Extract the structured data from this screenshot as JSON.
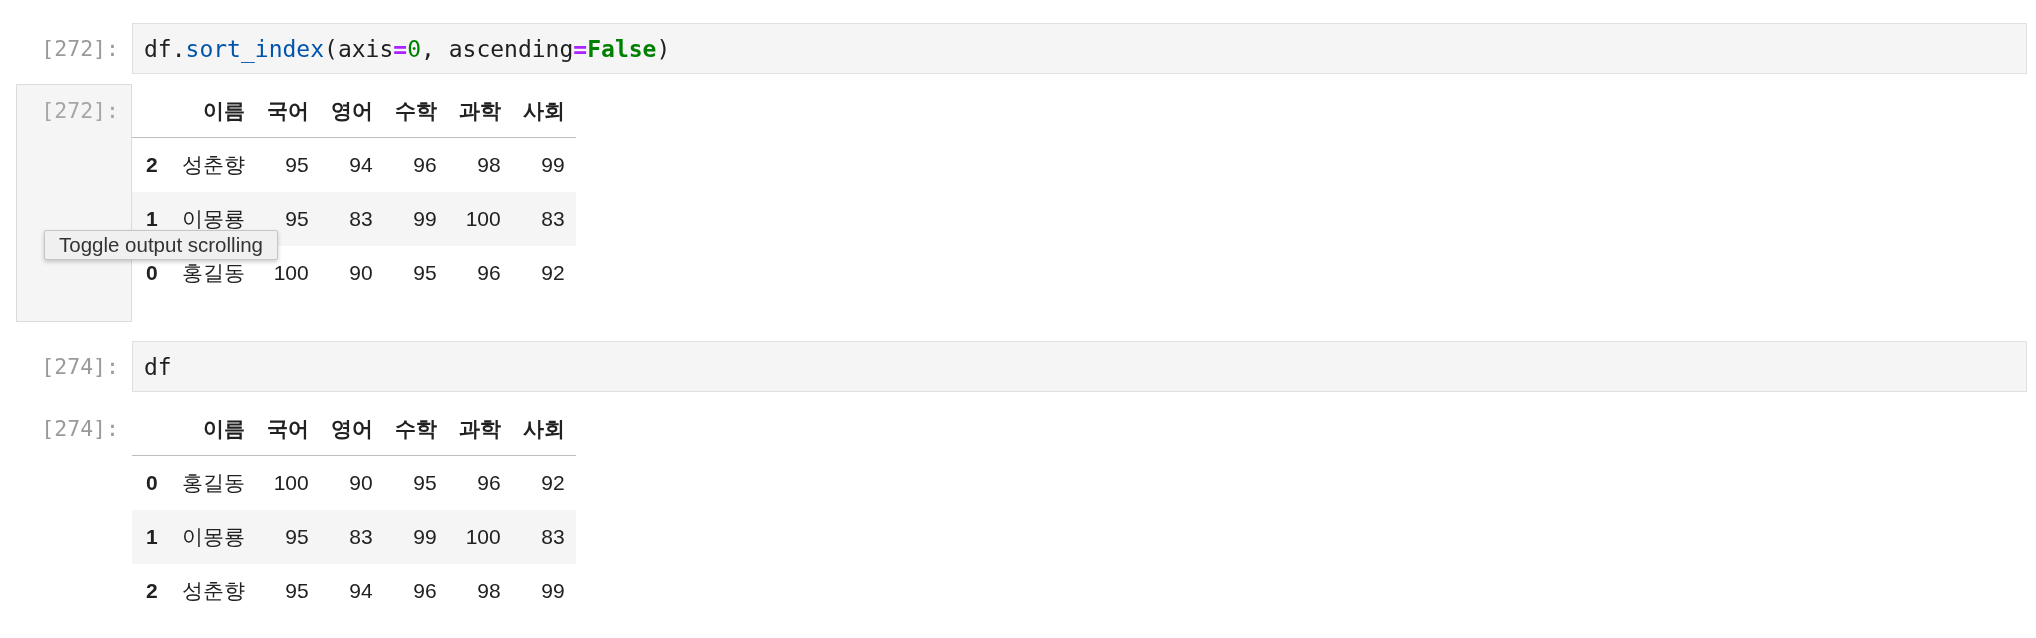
{
  "cells": [
    {
      "input": {
        "prompt": "[272]:",
        "code": [
          {
            "text": "df.",
            "kind": "plain"
          },
          {
            "text": "sort_index",
            "kind": "attribute"
          },
          {
            "text": "(axis",
            "kind": "plain"
          },
          {
            "text": "=",
            "kind": "operator"
          },
          {
            "text": "0",
            "kind": "number"
          },
          {
            "text": ", ascending",
            "kind": "plain"
          },
          {
            "text": "=",
            "kind": "operator"
          },
          {
            "text": "False",
            "kind": "keyword"
          },
          {
            "text": ")",
            "kind": "plain"
          }
        ]
      },
      "output": {
        "prompt": "[272]:",
        "hovered": true,
        "tooltip": "Toggle output scrolling",
        "table": {
          "columns": [
            "이름",
            "국어",
            "영어",
            "수학",
            "과학",
            "사회"
          ],
          "rows": [
            {
              "index": "2",
              "cells": [
                "성춘향",
                "95",
                "94",
                "96",
                "98",
                "99"
              ]
            },
            {
              "index": "1",
              "cells": [
                "이몽룡",
                "95",
                "83",
                "99",
                "100",
                "83"
              ]
            },
            {
              "index": "0",
              "cells": [
                "홍길동",
                "100",
                "90",
                "95",
                "96",
                "92"
              ]
            }
          ]
        }
      }
    },
    {
      "input": {
        "prompt": "[274]:",
        "code": [
          {
            "text": "df",
            "kind": "plain"
          }
        ]
      },
      "output": {
        "prompt": "[274]:",
        "hovered": false,
        "table": {
          "columns": [
            "이름",
            "국어",
            "영어",
            "수학",
            "과학",
            "사회"
          ],
          "rows": [
            {
              "index": "0",
              "cells": [
                "홍길동",
                "100",
                "90",
                "95",
                "96",
                "92"
              ]
            },
            {
              "index": "1",
              "cells": [
                "이몽룡",
                "95",
                "83",
                "99",
                "100",
                "83"
              ]
            },
            {
              "index": "2",
              "cells": [
                "성춘향",
                "95",
                "94",
                "96",
                "98",
                "99"
              ]
            }
          ]
        }
      }
    }
  ]
}
